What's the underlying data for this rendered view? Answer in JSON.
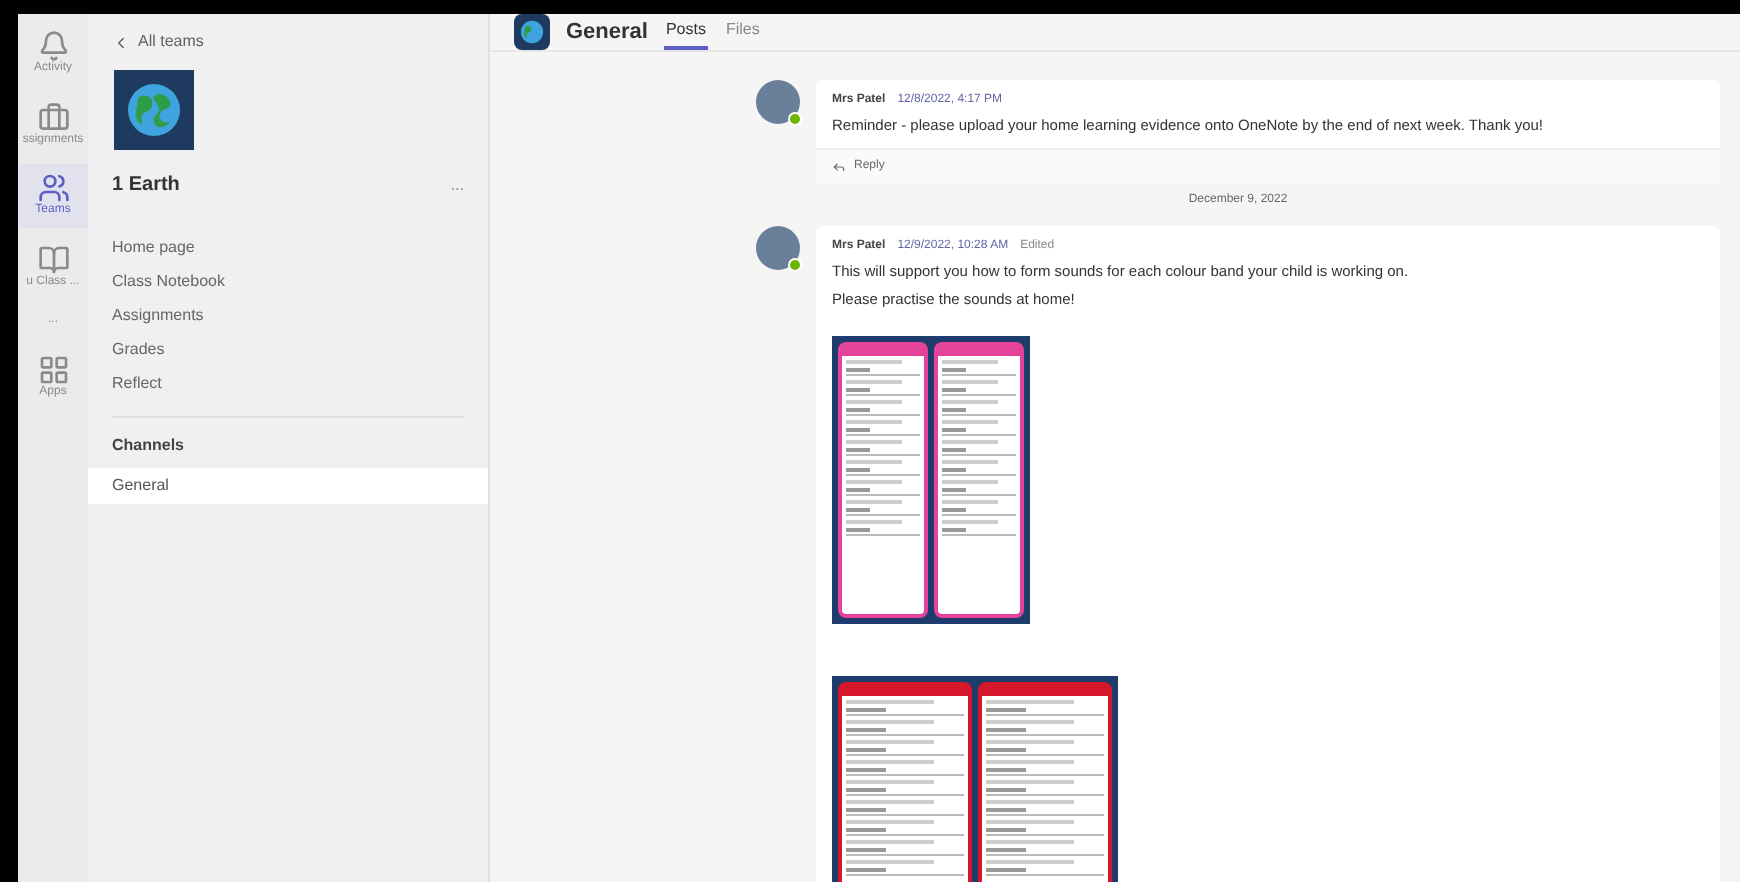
{
  "rail": [
    {
      "label": "Activity",
      "selected": false
    },
    {
      "label": "ssignments",
      "selected": false
    },
    {
      "label": "Teams",
      "selected": true
    },
    {
      "label": "u Class ...",
      "selected": false
    },
    {
      "label": "...",
      "selected": false
    },
    {
      "label": "Apps",
      "selected": false
    }
  ],
  "team_panel": {
    "back": "All teams",
    "team_name": "1 Earth",
    "more": "...",
    "items": [
      {
        "label": "Home page"
      },
      {
        "label": "Class Notebook"
      },
      {
        "label": "Assignments"
      },
      {
        "label": "Grades"
      },
      {
        "label": "Reflect"
      }
    ],
    "channels_heading": "Channels",
    "channels": [
      {
        "label": "General",
        "selected": true
      }
    ]
  },
  "header": {
    "title": "General",
    "tabs": [
      {
        "label": "Posts",
        "selected": true
      },
      {
        "label": "Files",
        "selected": false
      }
    ]
  },
  "feed": [
    {
      "kind": "post",
      "author": "Mrs Patel",
      "time": "12/8/2022, 4:17 PM",
      "lines": [
        "Reminder - please upload your home learning evidence onto OneNote by the end of next week. Thank you!"
      ],
      "reply": "Reply"
    },
    {
      "kind": "date",
      "text": "December 9, 2022"
    },
    {
      "kind": "post",
      "author": "Mrs Patel",
      "time": "12/9/2022, 10:28 AM",
      "edited": "Edited",
      "lines": [
        "This will support you how to form sounds for each colour band your child is working on.",
        "Please practise the sounds at home!"
      ],
      "images": [
        {
          "color": "#e5439a"
        },
        {
          "color": "#d6162b"
        }
      ]
    }
  ]
}
